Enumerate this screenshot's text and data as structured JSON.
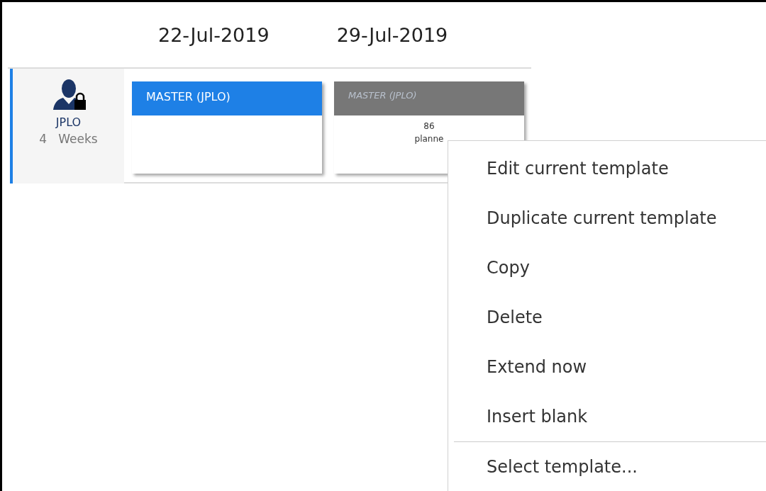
{
  "header": {
    "dates": [
      "22-Jul-2019",
      "29-Jul-2019"
    ]
  },
  "row": {
    "owner": {
      "name": "JPLO",
      "duration": "4   Weeks",
      "selected": true
    },
    "cards": [
      {
        "kind": "current",
        "title": "MASTER (JPLO)"
      },
      {
        "kind": "future",
        "title": "MASTER (JPLO)",
        "lines": [
          "86",
          "planne"
        ]
      }
    ]
  },
  "context_menu": {
    "groups": [
      [
        "Edit current template",
        "Duplicate current template",
        "Copy",
        "Delete",
        "Extend now",
        "Insert blank"
      ],
      [
        "Select template..."
      ]
    ]
  }
}
